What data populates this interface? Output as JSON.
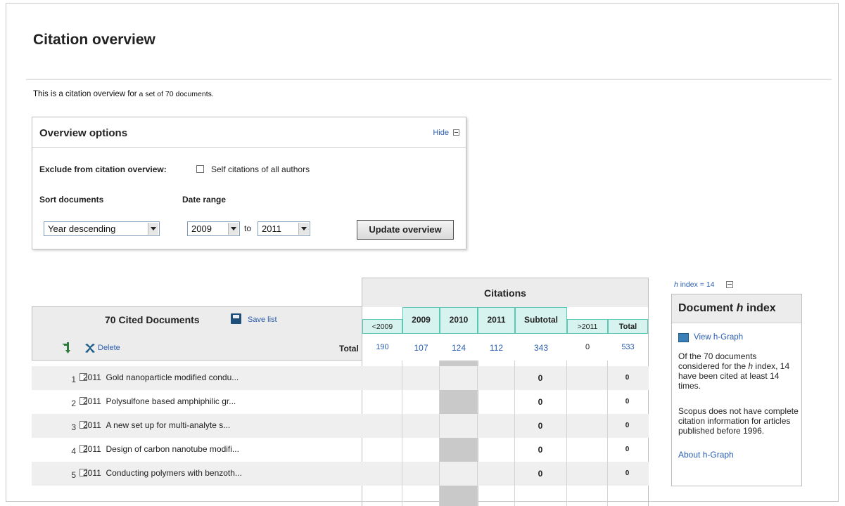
{
  "page": {
    "title": "Citation overview",
    "intro_lead": "This is a citation overview for",
    "intro_rest": " a set of 70 documents."
  },
  "options": {
    "title": "Overview options",
    "hide_label": "Hide",
    "exclude_label": "Exclude from citation overview:",
    "exclude_option": "Self citations of all authors",
    "exclude_checked": false,
    "sort_label": "Sort documents",
    "sort_value": "Year descending",
    "date_label": "Date range",
    "date_from": "2009",
    "to_label": "to",
    "date_to": "2011",
    "update_button": "Update overview"
  },
  "table": {
    "citations_header": "Citations",
    "doc_header": "70 Cited Documents",
    "save_label": "Save list",
    "delete_label": "Delete",
    "total_label": "Total",
    "columns": [
      "<2009",
      "2009",
      "2010",
      "2011",
      "Subtotal",
      ">2011",
      "Total"
    ],
    "totals": [
      "190",
      "107",
      "124",
      "112",
      "343",
      "0",
      "533"
    ],
    "rows": [
      {
        "num": "1",
        "year": "2011",
        "title": "Gold nanoparticle modified condu...",
        "subtotal": "0",
        "total": "0"
      },
      {
        "num": "2",
        "year": "2011",
        "title": "Polysulfone based amphiphilic gr...",
        "subtotal": "0",
        "total": "0"
      },
      {
        "num": "3",
        "year": "2011",
        "title": "A new set up for multi-analyte s...",
        "subtotal": "0",
        "total": "0"
      },
      {
        "num": "4",
        "year": "2011",
        "title": "Design of carbon nanotube modifi...",
        "subtotal": "0",
        "total": "0"
      },
      {
        "num": "5",
        "year": "2011",
        "title": "Conducting polymers with benzoth...",
        "subtotal": "0",
        "total": "0"
      }
    ]
  },
  "hindex": {
    "link_prefix": "h",
    "link_rest": " index = 14",
    "title_pre": "Document ",
    "title_h": "h",
    "title_post": " index",
    "view_graph": "View h-Graph",
    "desc1_a": "Of the 70 documents considered for the ",
    "desc1_h": "h",
    "desc1_b": " index, 14 have been cited at least 14 times.",
    "desc2": "Scopus does not have complete citation information for articles published before 1996.",
    "about_link": "About h-Graph"
  },
  "colors": {
    "link": "#2a5db0",
    "year_header_bg": "#d7f3ef",
    "year_header_border": "#5cc7b4",
    "header_gray": "#ececec"
  }
}
